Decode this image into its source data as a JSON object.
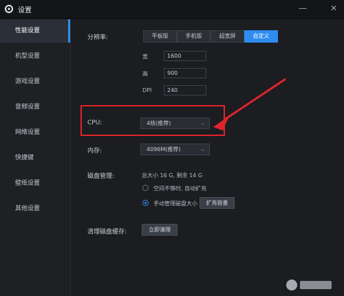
{
  "window": {
    "title": "设置",
    "minimize": "—",
    "close": "✕"
  },
  "sidebar": {
    "items": [
      {
        "label": "性能设置",
        "active": true
      },
      {
        "label": "机型设置"
      },
      {
        "label": "游戏设置"
      },
      {
        "label": "音频设置"
      },
      {
        "label": "网络设置"
      },
      {
        "label": "快捷键"
      },
      {
        "label": "壁纸设置"
      },
      {
        "label": "其他设置"
      }
    ]
  },
  "resolution": {
    "label": "分辨率:",
    "tabs": [
      "平板版",
      "手机版",
      "超宽屏",
      "自定义"
    ],
    "active_tab": "自定义",
    "width_label": "宽",
    "width_value": "1600",
    "height_label": "高",
    "height_value": "900",
    "dpi_label": "DPI",
    "dpi_value": "240"
  },
  "cpu": {
    "label": "CPU:",
    "value": "4核(推荐)"
  },
  "memory": {
    "label": "内存:",
    "value": "4096M(推荐)"
  },
  "disk": {
    "label": "磁盘管理:",
    "info": "总大小 16 G, 剩余 14 G",
    "option_auto": "空间不够时, 自动扩充",
    "option_manual": "手动管理磁盘大小",
    "expand_button": "扩充容量",
    "selected": "manual"
  },
  "cache": {
    "label": "清理磁盘缓存:",
    "button": "立即清理"
  },
  "colors": {
    "accent": "#2f8cf0",
    "highlight": "#e0242a",
    "background": "#1b1d21"
  },
  "icons": {
    "title": "gear-icon",
    "arrow": "red-arrow"
  }
}
